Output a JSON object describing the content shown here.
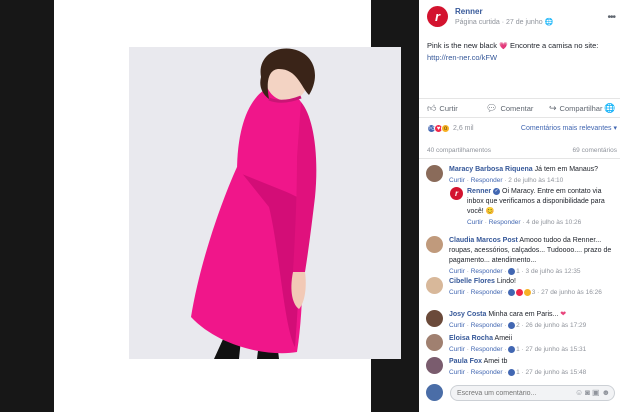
{
  "post": {
    "page_name": "Renner",
    "page_initial": "r",
    "page_type": "Página curtida",
    "separator": "·",
    "date": "27 de junho",
    "text": "Pink is the new black",
    "text_cont": "Encontre a camisa no site:",
    "link": "http://ren-ner.co/kFW"
  },
  "actions": {
    "like": "Curtir",
    "comment": "Comentar",
    "share": "Compartilhar"
  },
  "reactions": {
    "count": "2,6 mil",
    "sort_label": "Comentários mais relevantes ▾",
    "shares": "40 compartilhamentos",
    "comments": "69 comentários"
  },
  "comments": [
    {
      "name": "Maracy Barbosa Riquena",
      "text": "Já tem em Manaus?",
      "like": "Curtir",
      "reply": "Responder",
      "dot": "·",
      "time": "2 de julho às 14:10"
    },
    {
      "name": "Claudia Marcos Post",
      "text": "Amooo tudoo da Renner... roupas, acessórios, calçados... Tudoooo.... prazo de pagamento... atendimento...",
      "like": "Curtir",
      "reply": "Responder",
      "dot": "·",
      "reacts": "1",
      "time": "3 de julho às 12:35"
    },
    {
      "name": "Cibelle Flores",
      "text": "Lindo!",
      "like": "Curtir",
      "reply": "Responder",
      "dot": "·",
      "reacts": "3",
      "time": "27 de junho às 16:26"
    },
    {
      "name": "Josy Costa",
      "text": "Minha cara em Paris...",
      "like": "Curtir",
      "reply": "Responder",
      "dot": "·",
      "reacts": "2",
      "time": "26 de junho às 17:29"
    },
    {
      "name": "Eloisa Rocha",
      "text": "Ameii",
      "like": "Curtir",
      "reply": "Responder",
      "dot": "·",
      "reacts": "1",
      "time": "27 de junho às 15:31"
    },
    {
      "name": "Paula Fox",
      "text": "Amei tb",
      "like": "Curtir",
      "reply": "Responder",
      "dot": "·",
      "reacts": "1",
      "time": "27 de junho às 15:48"
    }
  ],
  "reply": {
    "name": "Renner",
    "text": "Oi Maracy. Entre em contato via inbox que verificamos a disponibilidade para você!",
    "like": "Curtir",
    "reply": "Responder",
    "dot": "·",
    "time": "4 de julho às 10:26"
  },
  "composer": {
    "placeholder": "Escreva um comentário..."
  },
  "colors": {
    "brand_red": "#d3132f",
    "link_blue": "#365899",
    "dress_pink": "#f0168a"
  },
  "icons": [
    "thumb-up-icon",
    "comment-icon",
    "share-icon",
    "more-icon",
    "globe-icon",
    "verified-icon",
    "emoji-icon",
    "camera-icon",
    "gif-icon",
    "sticker-icon"
  ]
}
